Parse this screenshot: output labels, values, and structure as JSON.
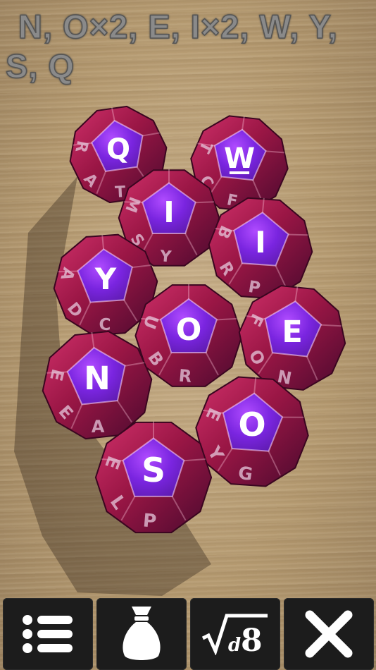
{
  "summary": {
    "text": "N, O×2, E, I×2, W, Y, S, Q"
  },
  "dice": [
    {
      "top": "Q",
      "sides": [
        "R",
        "T",
        "A"
      ]
    },
    {
      "top": "W",
      "sides": [
        "T",
        "F",
        "C"
      ],
      "underline": true
    },
    {
      "top": "I",
      "sides": [
        "M",
        "Y",
        "S"
      ]
    },
    {
      "top": "I",
      "sides": [
        "B",
        "P",
        "R"
      ]
    },
    {
      "top": "Y",
      "sides": [
        "A",
        "C",
        "D"
      ]
    },
    {
      "top": "O",
      "sides": [
        "U",
        "R",
        "B"
      ]
    },
    {
      "top": "E",
      "sides": [
        "F",
        "N",
        "O"
      ]
    },
    {
      "top": "N",
      "sides": [
        "E",
        "A",
        "E"
      ]
    },
    {
      "top": "O",
      "sides": [
        "E",
        "G",
        "Y"
      ]
    },
    {
      "top": "S",
      "sides": [
        "E",
        "P",
        "L"
      ]
    }
  ],
  "toolbar": {
    "menu_icon": "list-icon",
    "bag_icon": "money-bag-icon",
    "roll_icon": "sqrt-d8-icon",
    "roll_label_d": "d",
    "roll_label_num": "8",
    "close_icon": "close-icon"
  },
  "colors": {
    "die_red": "#b01a4a",
    "die_purple": "#6a1fd0",
    "toolbar_bg": "#1c1c1c",
    "summary_text": "#8a8a8a"
  }
}
